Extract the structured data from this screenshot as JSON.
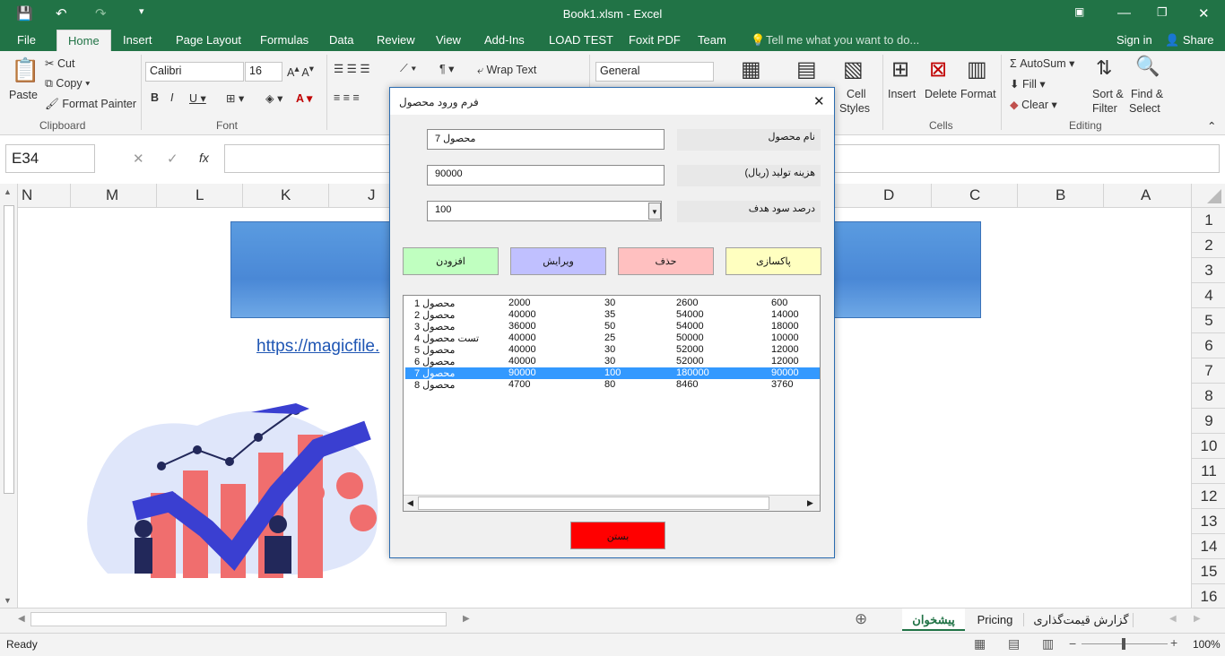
{
  "window": {
    "title": "Book1.xlsm - Excel"
  },
  "tabs": [
    "File",
    "Home",
    "Insert",
    "Page Layout",
    "Formulas",
    "Data",
    "Review",
    "View",
    "Add-Ins",
    "LOAD TEST",
    "Foxit PDF",
    "Team"
  ],
  "tell_me": "Tell me what you want to do...",
  "signin": "Sign in",
  "share": "Share",
  "clipboard": {
    "paste": "Paste",
    "cut": "Cut",
    "copy": "Copy",
    "format_painter": "Format Painter",
    "group": "Clipboard"
  },
  "font": {
    "name": "Calibri",
    "size": "16",
    "group": "Font"
  },
  "alignment": {
    "wrap": "Wrap Text"
  },
  "number": {
    "format": "General"
  },
  "styles": {
    "cell_styles": "Cell",
    "cell_styles2": "Styles"
  },
  "cells": {
    "insert": "Insert",
    "delete": "Delete",
    "format": "Format",
    "group": "Cells"
  },
  "editing": {
    "autosum": "AutoSum",
    "fill": "Fill",
    "clear": "Clear",
    "sort": "Sort &",
    "sort2": "Filter",
    "find": "Find &",
    "find2": "Select",
    "group": "Editing"
  },
  "namebox": "E34",
  "fx": "fx",
  "columns": [
    "N",
    "M",
    "L",
    "K",
    "J",
    "D",
    "C",
    "B",
    "A"
  ],
  "rows": [
    "1",
    "2",
    "3",
    "4",
    "5",
    "6",
    "7",
    "8",
    "9",
    "10",
    "11",
    "12",
    "13",
    "14",
    "15",
    "16"
  ],
  "link_text": "https://magicfile.",
  "dialog": {
    "title": "فرم ورود محصول",
    "fields": [
      {
        "label": "نام محصول",
        "value": "محصول 7"
      },
      {
        "label": "هزینه تولید (ریال)",
        "value": "90000"
      },
      {
        "label": "درصد سود هدف",
        "value": "100"
      }
    ],
    "buttons": {
      "clear": "پاکسازی",
      "delete": "حذف",
      "edit": "ویرایش",
      "add": "افزودن",
      "close": "بستن"
    },
    "list": [
      [
        "محصول 1",
        "2000",
        "30",
        "2600",
        "600"
      ],
      [
        "محصول 2",
        "40000",
        "35",
        "54000",
        "14000"
      ],
      [
        "محصول 3",
        "36000",
        "50",
        "54000",
        "18000"
      ],
      [
        "تست محصول 4",
        "40000",
        "25",
        "50000",
        "10000"
      ],
      [
        "محصول 5",
        "40000",
        "30",
        "52000",
        "12000"
      ],
      [
        "محصول 6",
        "40000",
        "30",
        "52000",
        "12000"
      ],
      [
        "محصول 7",
        "90000",
        "100",
        "180000",
        "90000"
      ],
      [
        "محصول 8",
        "4700",
        "80",
        "8460",
        "3760"
      ]
    ],
    "selected_row": 6
  },
  "sheets": [
    "پیشخوان",
    "Pricing",
    "گزارش قیمت‌گذاری"
  ],
  "status": {
    "ready": "Ready",
    "zoom": "100%"
  },
  "colors": {
    "excel_green": "#217346",
    "selection": "#3399ff",
    "close_btn": "#ff0000"
  }
}
